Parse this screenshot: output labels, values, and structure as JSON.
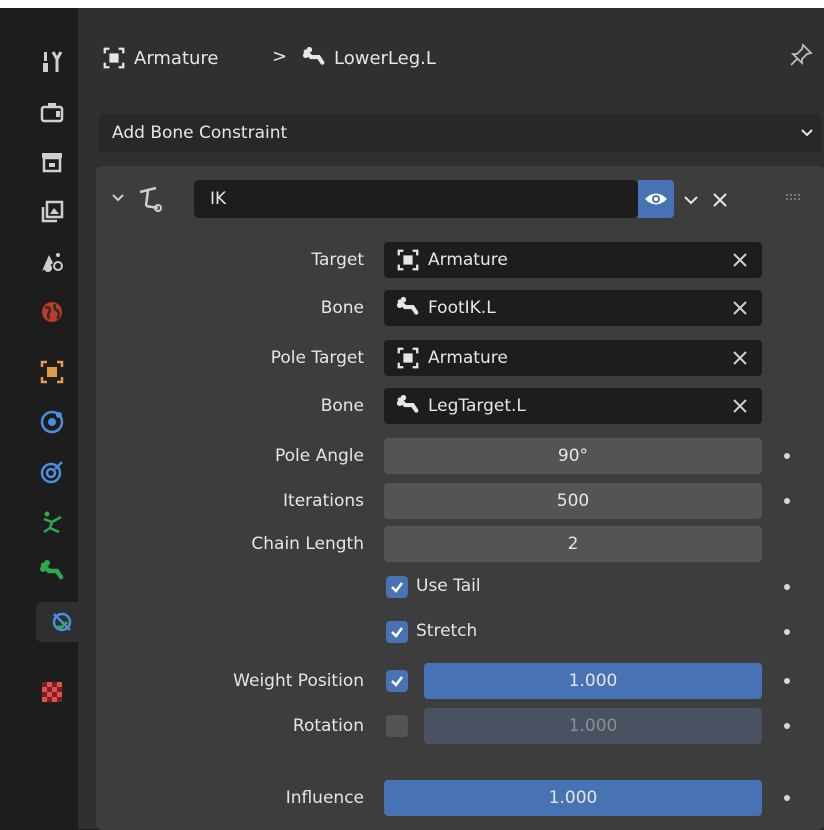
{
  "sidebar": {
    "tabs": [
      {
        "name": "tool-tab",
        "icon": "tool-icon",
        "active": false
      },
      {
        "name": "render-tab",
        "icon": "render-icon",
        "active": false
      },
      {
        "name": "output-tab",
        "icon": "output-icon",
        "active": false
      },
      {
        "name": "view-layer-tab",
        "icon": "view-layer-icon",
        "active": false
      },
      {
        "name": "scene-tab",
        "icon": "scene-icon",
        "active": false
      },
      {
        "name": "world-tab",
        "icon": "world-icon",
        "active": false
      },
      {
        "name": "object-tab",
        "icon": "object-icon",
        "active": false
      },
      {
        "name": "modifiers-tab",
        "icon": "modifier-icon",
        "active": false
      },
      {
        "name": "physics-tab",
        "icon": "physics-icon",
        "active": false
      },
      {
        "name": "object-data-tab",
        "icon": "armature-data-icon",
        "active": false
      },
      {
        "name": "bone-tab",
        "icon": "bone-icon",
        "active": false
      },
      {
        "name": "bone-constraints-tab",
        "icon": "bone-constraint-icon",
        "active": true
      },
      {
        "name": "texture-tab",
        "icon": "texture-icon",
        "active": false
      }
    ]
  },
  "header": {
    "object_name": "Armature",
    "separator": ">",
    "bone_name": "LowerLeg.L"
  },
  "add_constraint": {
    "label": "Add Bone Constraint"
  },
  "constraint": {
    "name": "IK",
    "target_label": "Target",
    "target_value": "Armature",
    "bone_label": "Bone",
    "bone_value": "FootIK.L",
    "pole_target_label": "Pole Target",
    "pole_target_value": "Armature",
    "pole_bone_label": "Bone",
    "pole_bone_value": "LegTarget.L",
    "pole_angle_label": "Pole Angle",
    "pole_angle_value": "90°",
    "iterations_label": "Iterations",
    "iterations_value": "500",
    "chain_length_label": "Chain Length",
    "chain_length_value": "2",
    "use_tail_label": "Use Tail",
    "use_tail_checked": true,
    "stretch_label": "Stretch",
    "stretch_checked": true,
    "weight_position_label": "Weight Position",
    "weight_position_checked": true,
    "weight_position_value": "1.000",
    "rotation_label": "Rotation",
    "rotation_checked": false,
    "rotation_value": "1.000",
    "influence_label": "Influence",
    "influence_value": "1.000"
  },
  "colors": {
    "accent_blue": "#4772b3",
    "panel_bg": "#3d3d3d",
    "field_bg": "#1d1d1d",
    "object_orange": "#e59a4a",
    "bone_green": "#2fa84f"
  }
}
